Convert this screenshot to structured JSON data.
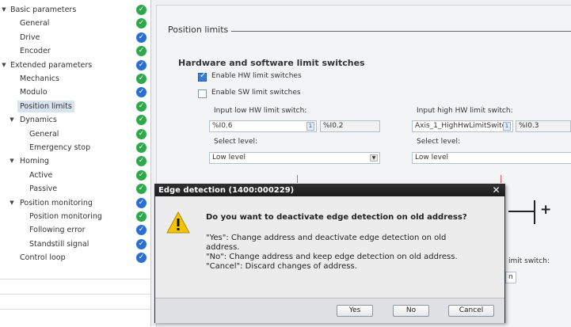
{
  "nav": {
    "items": [
      {
        "label": "Basic parameters",
        "level": 0,
        "expanded": true,
        "status": "green"
      },
      {
        "label": "General",
        "level": 1,
        "status": "green"
      },
      {
        "label": "Drive",
        "level": 1,
        "status": "blue"
      },
      {
        "label": "Encoder",
        "level": 1,
        "status": "green"
      },
      {
        "label": "Extended parameters",
        "level": 0,
        "expanded": true,
        "status": "blue"
      },
      {
        "label": "Mechanics",
        "level": 1,
        "status": "green"
      },
      {
        "label": "Modulo",
        "level": 1,
        "status": "blue"
      },
      {
        "label": "Position limits",
        "level": 1,
        "status": "green",
        "selected": true
      },
      {
        "label": "Dynamics",
        "level": 1,
        "expanded": true,
        "status": "green"
      },
      {
        "label": "General",
        "level": 2,
        "status": "green"
      },
      {
        "label": "Emergency stop",
        "level": 2,
        "status": "green"
      },
      {
        "label": "Homing",
        "level": 1,
        "expanded": true,
        "status": "green"
      },
      {
        "label": "Active",
        "level": 2,
        "status": "green"
      },
      {
        "label": "Passive",
        "level": 2,
        "status": "green"
      },
      {
        "label": "Position monitoring",
        "level": 1,
        "expanded": true,
        "status": "blue"
      },
      {
        "label": "Position monitoring",
        "level": 2,
        "status": "green"
      },
      {
        "label": "Following error",
        "level": 2,
        "status": "blue"
      },
      {
        "label": "Standstill signal",
        "level": 2,
        "status": "blue"
      },
      {
        "label": "Control loop",
        "level": 1,
        "status": "blue"
      }
    ]
  },
  "main": {
    "section_title": "Position limits",
    "group_title": "Hardware and software limit switches",
    "enable_hw_label": "Enable HW limit switches",
    "enable_hw_checked": true,
    "enable_sw_label": "Enable SW limit switches",
    "enable_sw_checked": false,
    "low_hw_label": "Input low HW limit switch:",
    "low_hw_value": "%I0.6",
    "low_hw_address": "%I0.2",
    "high_hw_label": "Input high HW limit switch:",
    "high_hw_value": "Axis_1_HighHwLimitSwitc",
    "high_hw_address": "%I0.3",
    "select_level_label_1": "Select level:",
    "select_level_value_1": "Low level",
    "select_level_label_2": "Select level:",
    "select_level_value_2": "Low level",
    "partial_label": "imit switch:",
    "partial_field": "n"
  },
  "dialog": {
    "title": "Edge detection (1400:000229)",
    "question": "Do you want to deactivate edge detection on old address?",
    "body_lines": [
      "\"Yes\": Change address and deactivate edge detection on old",
      "address.",
      "\"No\": Change address and keep edge detection on old address.",
      "\"Cancel\": Discard changes of address."
    ],
    "yes_label": "Yes",
    "no_label": "No",
    "cancel_label": "Cancel",
    "close_glyph": "✕"
  },
  "icons": {
    "status_green": "check-green-icon",
    "status_blue": "check-blue-icon",
    "warning": "warning-icon"
  },
  "colors": {
    "status_green": "#2ea84b",
    "status_blue": "#2a6fd1",
    "selected_bg": "#d7e3ef",
    "titlebar": "#1c1c1c"
  }
}
